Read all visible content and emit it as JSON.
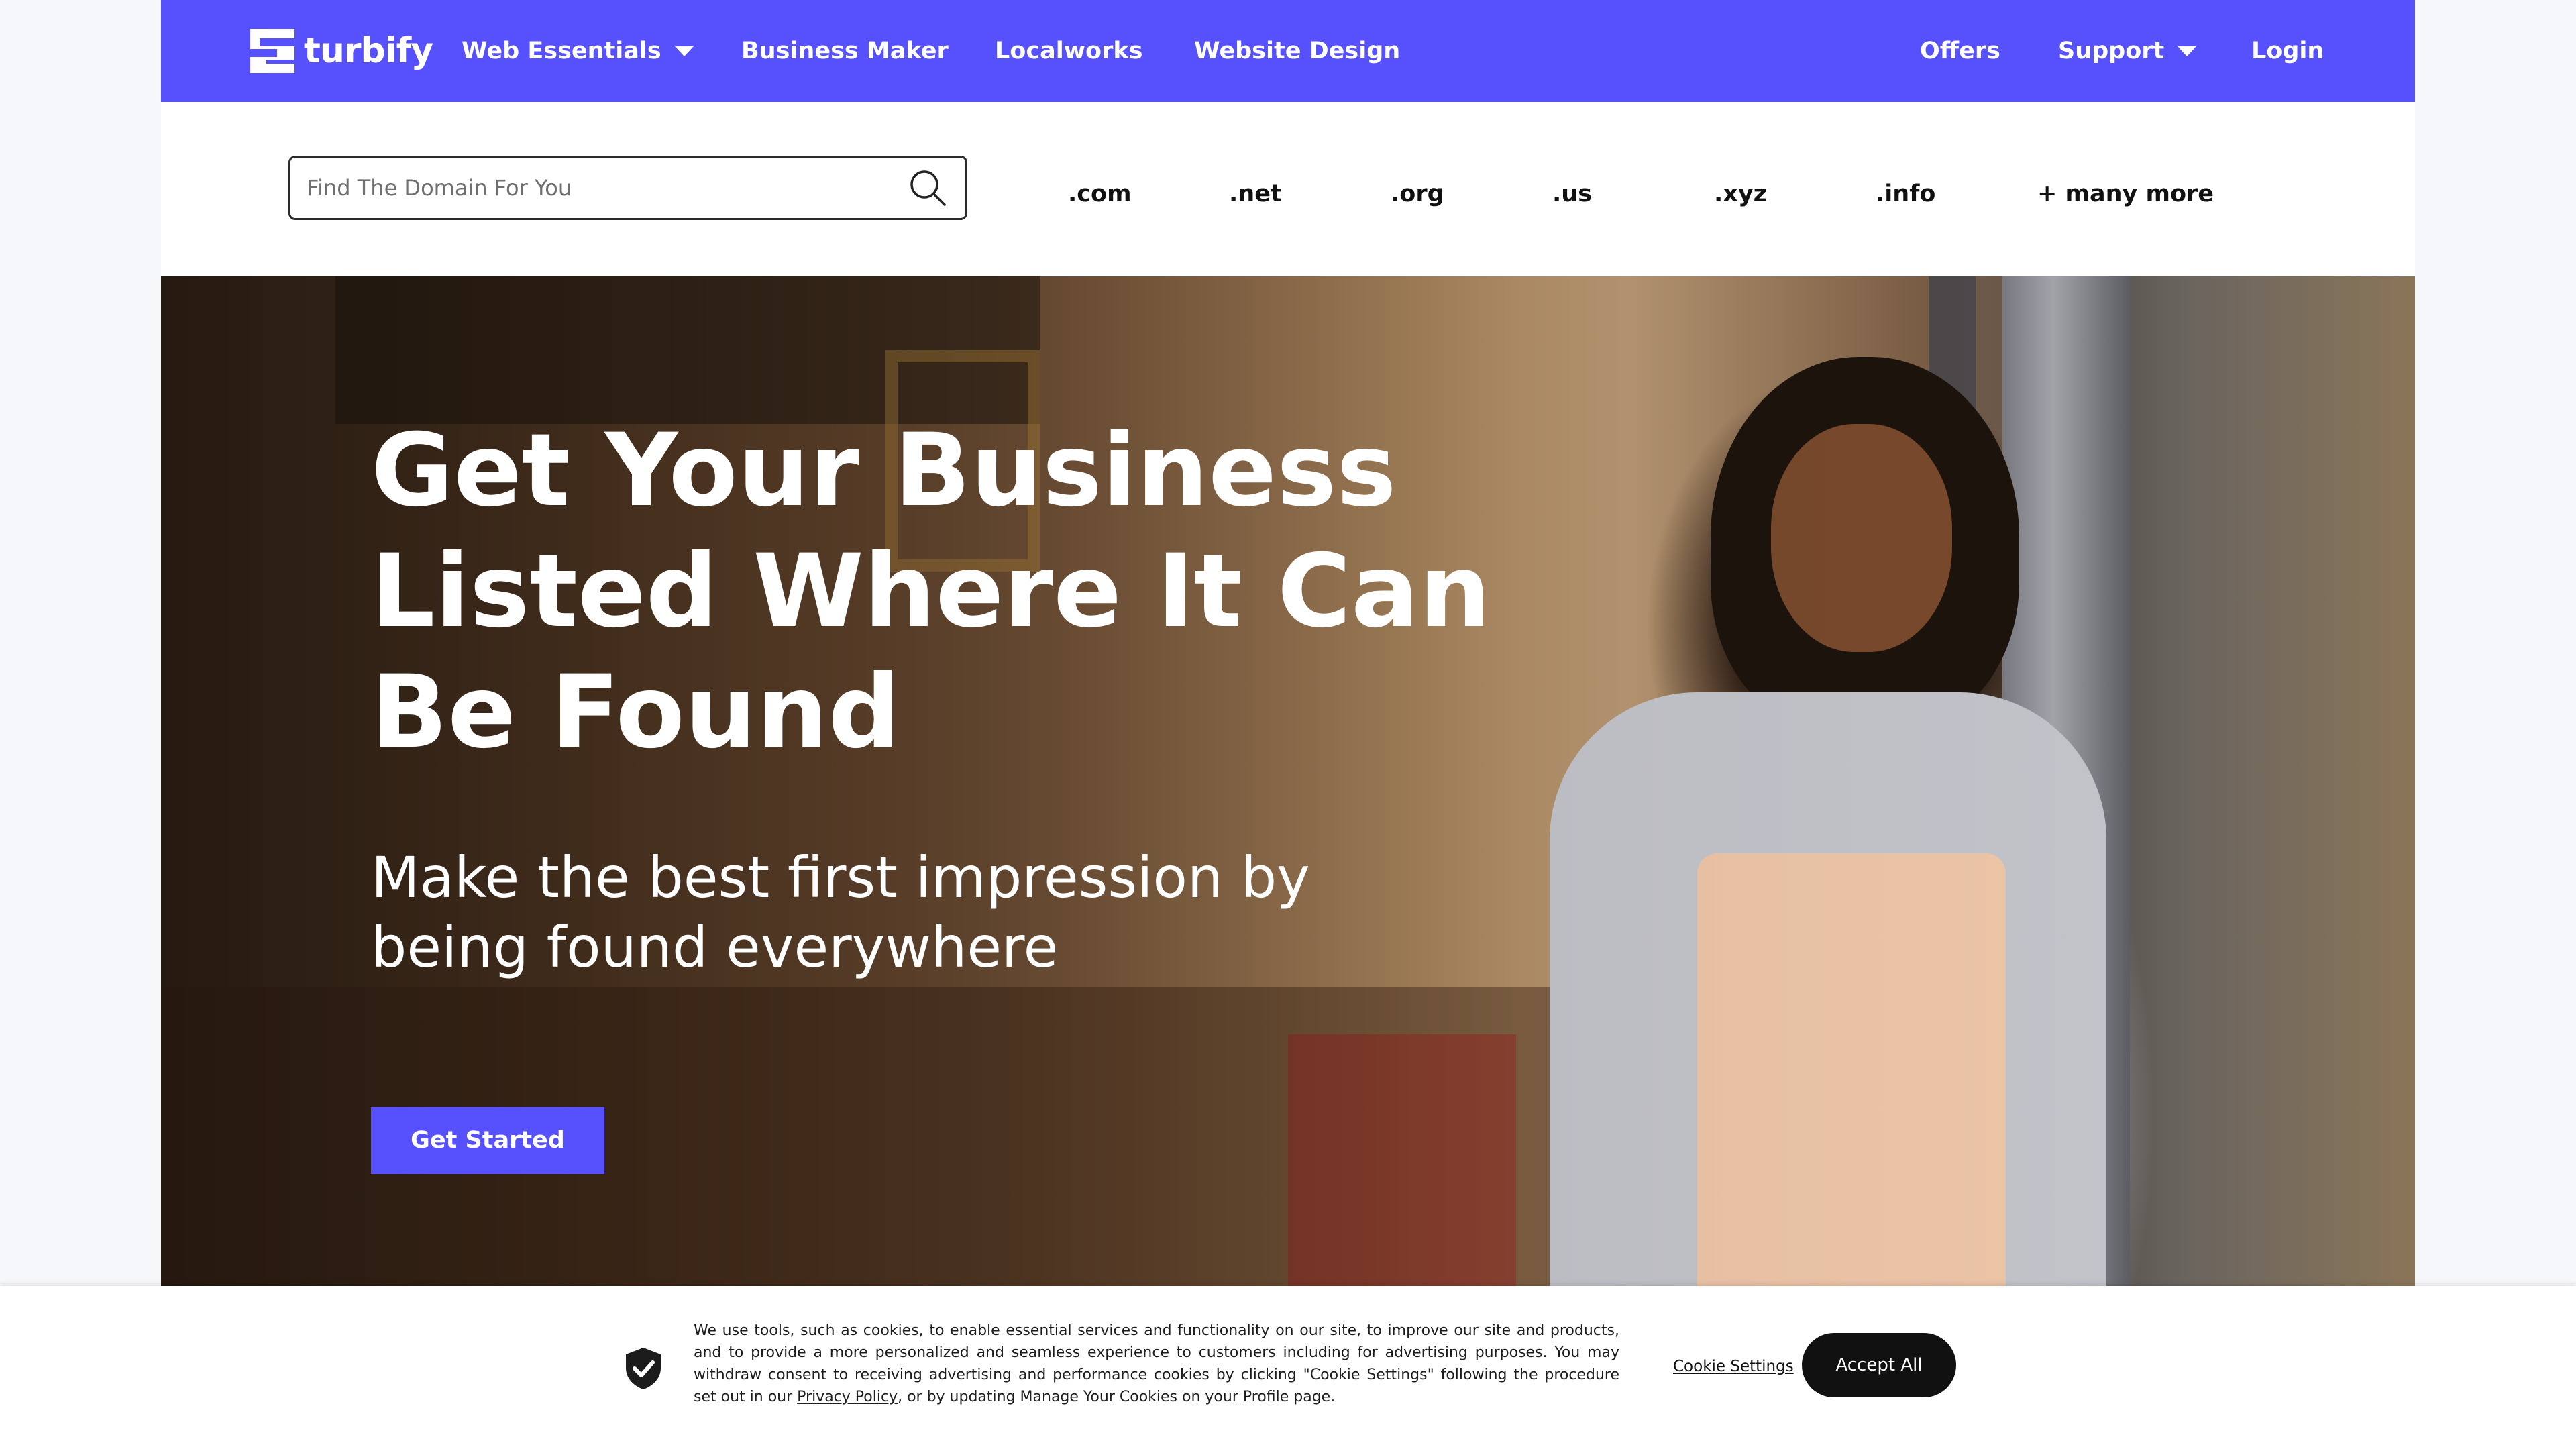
{
  "brand": {
    "name": "turbify"
  },
  "nav": {
    "items": [
      {
        "label": "Web Essentials",
        "has_dropdown": true
      },
      {
        "label": "Business Maker",
        "has_dropdown": false
      },
      {
        "label": "Localworks",
        "has_dropdown": false
      },
      {
        "label": "Website Design",
        "has_dropdown": false
      }
    ],
    "right": [
      {
        "label": "Offers",
        "has_dropdown": false
      },
      {
        "label": "Support",
        "has_dropdown": true
      },
      {
        "label": "Login",
        "has_dropdown": false
      }
    ]
  },
  "domain_search": {
    "placeholder": "Find The Domain For You",
    "value": "",
    "icon": "search-icon",
    "tlds": [
      ".com",
      ".net",
      ".org",
      ".us",
      ".xyz",
      ".info",
      "+ many more"
    ]
  },
  "hero": {
    "title": "Get Your Business Listed Where It Can Be Found",
    "subtitle": "Make the best first impression by being found everywhere",
    "cta_label": "Get Started"
  },
  "cookie_banner": {
    "icon": "shield-check-icon",
    "text_part1": "We use tools, such as cookies, to enable essential services and functionality on our site, to improve our site and products, and to provide a more personalized and seamless experience to customers including for advertising purposes. You may withdraw consent to receiving advertising and performance cookies by clicking \"Cookie Settings\" following the procedure set out in our ",
    "privacy_link": "Privacy Policy",
    "text_part2": ", or by updating Manage Your Cookies on your Profile page.",
    "settings_label": "Cookie Settings",
    "accept_label": "Accept All"
  },
  "colors": {
    "brand_primary": "#5750fd",
    "accept_button": "#111111",
    "page_background": "#f6f7fa"
  }
}
